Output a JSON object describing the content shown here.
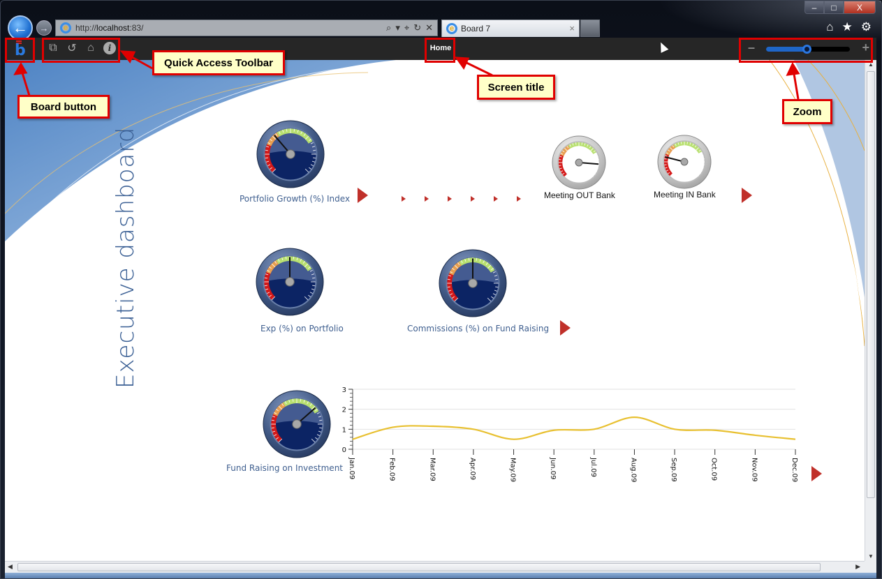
{
  "browser": {
    "url_prefix": "http://",
    "url_host": "localhost",
    "url_suffix": ":83/",
    "tab_title": "Board 7",
    "ie_icon_letter": "e",
    "window_controls": {
      "minimize": "–",
      "maximize": "□",
      "close": "X"
    },
    "nav_back_glyph": "←",
    "nav_forward_glyph": "→",
    "addr_tools": [
      "⌕",
      "▾",
      "⌖",
      "↻",
      "✕"
    ],
    "tab_close": "×",
    "ie_tools": [
      "home-icon",
      "favorites-star-icon",
      "settings-gear-icon"
    ],
    "ie_tool_glyphs": [
      "⌂",
      "★",
      "⚙"
    ]
  },
  "appbar": {
    "board_button_letter": "b",
    "quick_access": [
      {
        "name": "windows-icon",
        "glyph": "⧉"
      },
      {
        "name": "refresh-icon",
        "glyph": "↺"
      },
      {
        "name": "home-icon",
        "glyph": "⌂"
      },
      {
        "name": "info-icon",
        "glyph": "i"
      }
    ],
    "screen_title": "Home",
    "zoom": {
      "minus": "–",
      "plus": "+",
      "level_fraction": 0.48
    }
  },
  "annotations": {
    "board_button": "Board button",
    "quick_access_toolbar": "Quick Access Toolbar",
    "screen_title": "Screen title",
    "zoom": "Zoom",
    "highlight_color": "#e00000",
    "callout_bg": "#ffffc8"
  },
  "dashboard": {
    "title": "Executive dashboard",
    "accent_color": "#3a5f94",
    "gauges": [
      {
        "label": "Portfolio Growth (%) Index",
        "style": "dark",
        "needle_fraction": 0.35
      },
      {
        "label": "Meeting OUT Bank",
        "style": "light",
        "needle_fraction": 0.85
      },
      {
        "label": "Meeting IN Bank",
        "style": "light",
        "needle_fraction": 0.22
      },
      {
        "label": "Exp (%) on Portfolio",
        "style": "dark",
        "needle_fraction": 0.5
      },
      {
        "label": "Commissions (%) on Fund Raising",
        "style": "dark",
        "needle_fraction": 0.5
      },
      {
        "label": "Fund Raising on Investment",
        "style": "dark",
        "needle_fraction": 0.68
      }
    ]
  },
  "chart_data": {
    "type": "line",
    "title": "",
    "xlabel": "",
    "ylabel": "",
    "categories": [
      "Jan.09",
      "Feb.09",
      "Mar.09",
      "Apr.09",
      "May.09",
      "Jun.09",
      "Jul.09",
      "Aug.09",
      "Sep.09",
      "Oct.09",
      "Nov.09",
      "Dec.09"
    ],
    "series": [
      {
        "name": "Fund Raising on Investment",
        "color": "#e8c030",
        "values": [
          0.5,
          1.1,
          1.15,
          1.0,
          0.5,
          0.95,
          1.0,
          1.6,
          1.0,
          0.95,
          0.7,
          0.5
        ]
      }
    ],
    "ylim": [
      0,
      3
    ],
    "yticks": [
      0,
      1,
      2,
      3
    ],
    "grid": true,
    "legend": "none"
  }
}
